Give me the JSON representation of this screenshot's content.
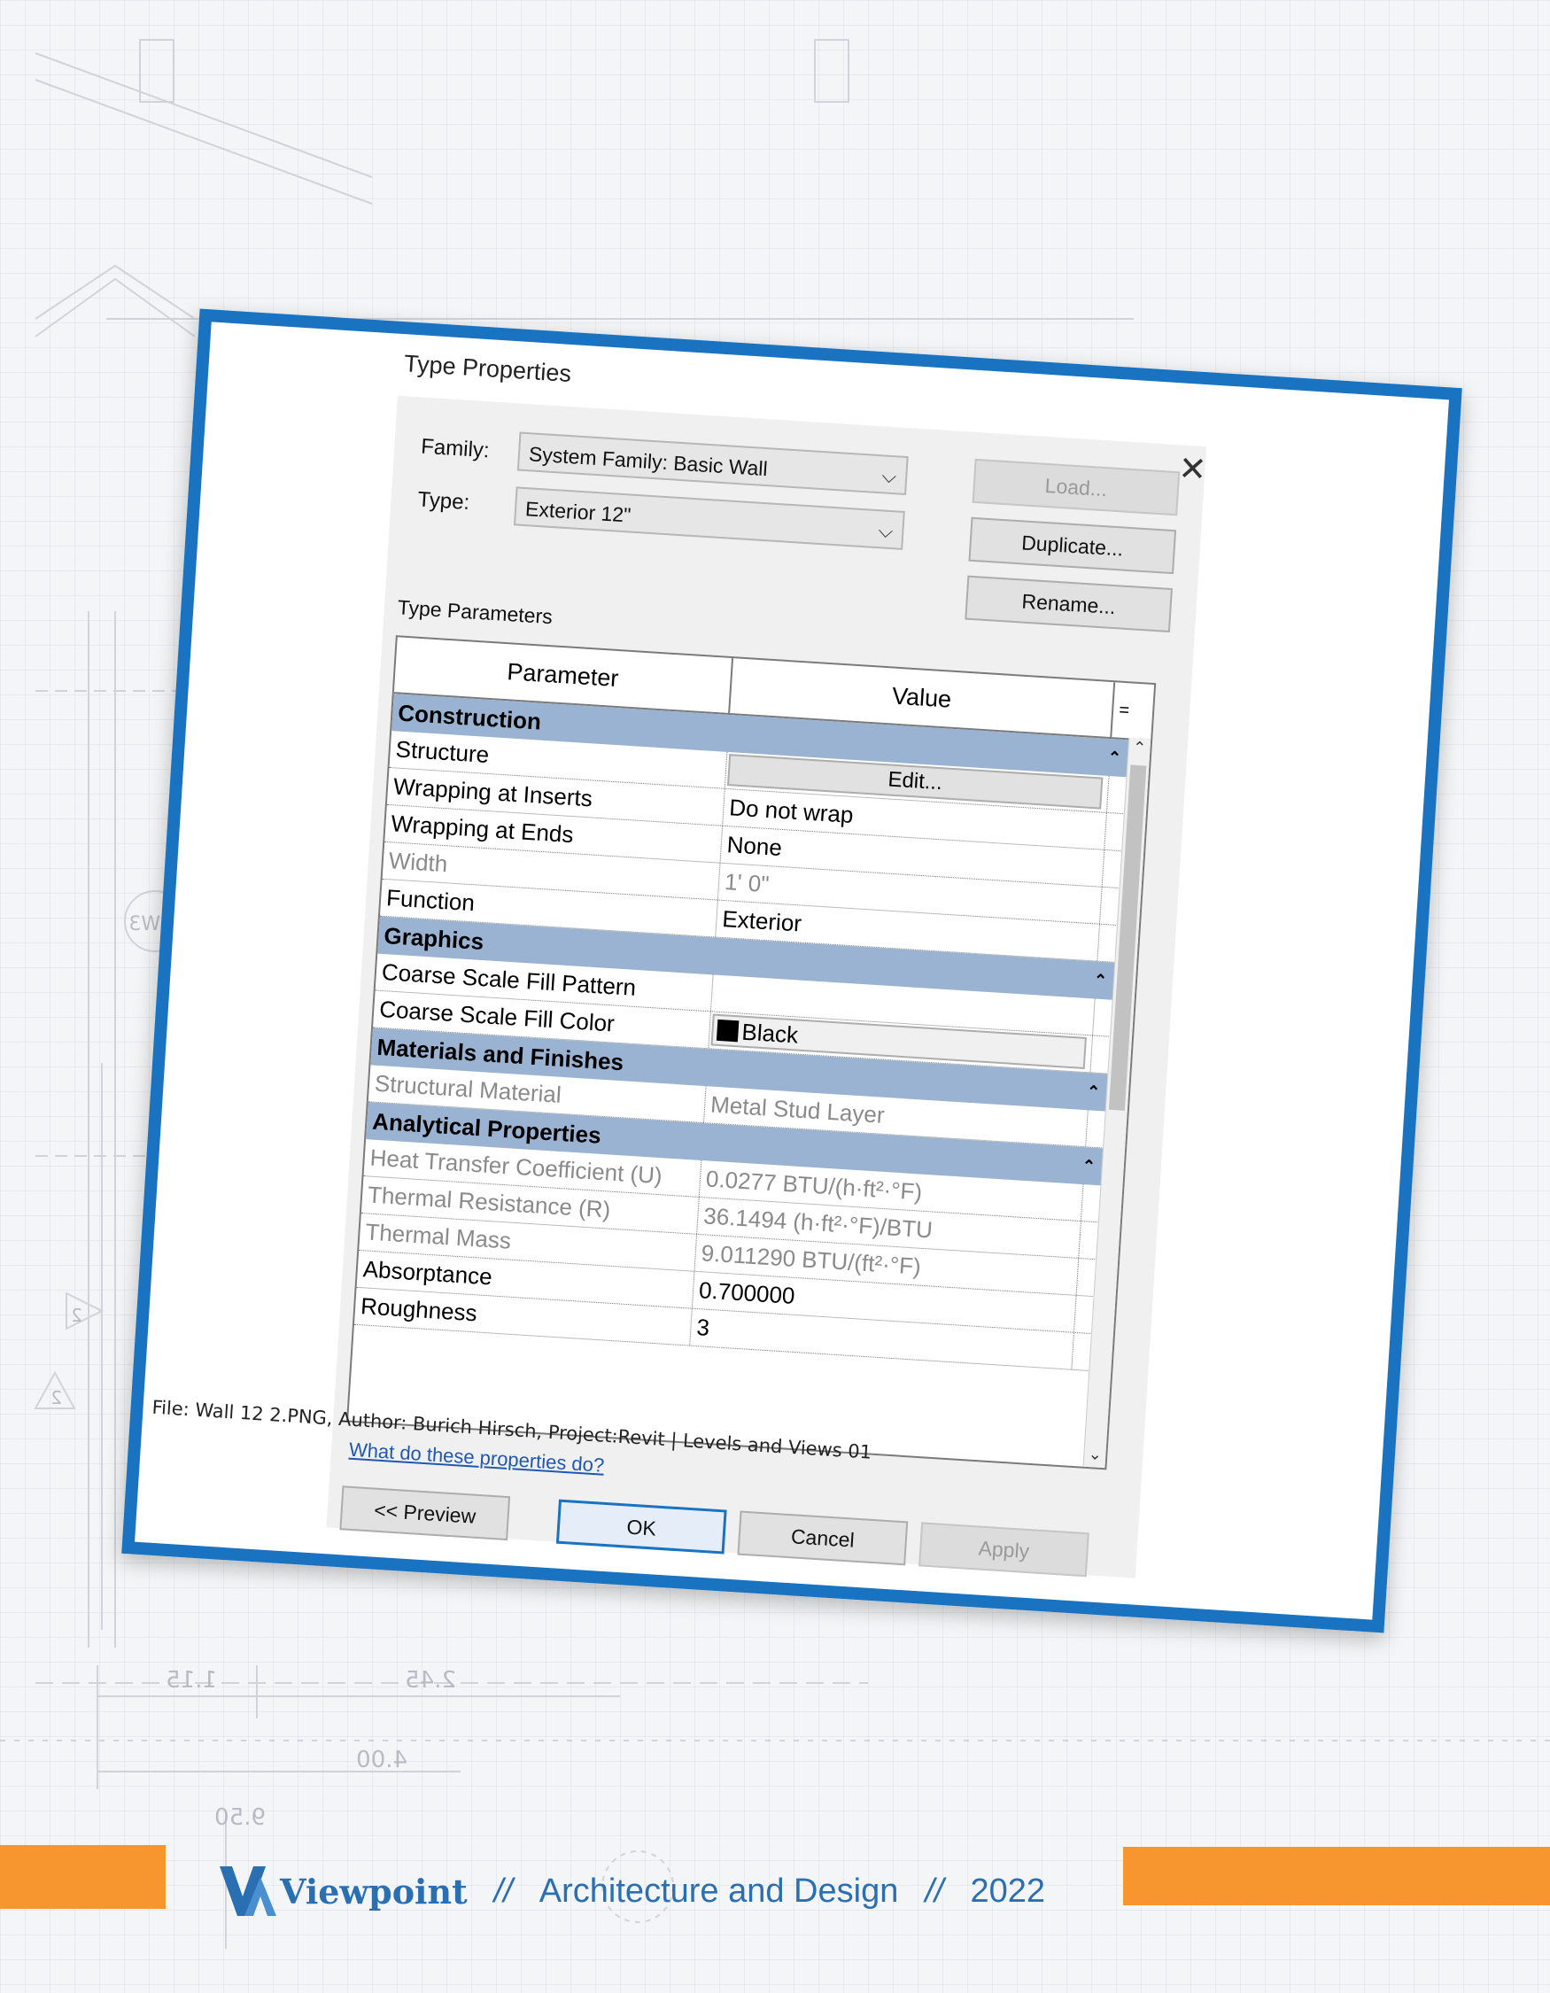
{
  "dialog": {
    "title": "Type Properties",
    "family_label": "Family:",
    "family_value": "System Family: Basic Wall",
    "type_label": "Type:",
    "type_value": "Exterior 12\"",
    "load_label": "Load...",
    "duplicate_label": "Duplicate...",
    "rename_label": "Rename...",
    "type_parameters_label": "Type Parameters",
    "col_parameter": "Parameter",
    "col_value": "Value",
    "col_eq": "=",
    "groups": {
      "construction": "Construction",
      "graphics": "Graphics",
      "materials": "Materials and Finishes",
      "analytical": "Analytical Properties"
    },
    "rows": {
      "structure": {
        "param": "Structure",
        "value": "Edit..."
      },
      "wrap_inserts": {
        "param": "Wrapping at Inserts",
        "value": "Do not wrap"
      },
      "wrap_ends": {
        "param": "Wrapping at Ends",
        "value": "None"
      },
      "width": {
        "param": "Width",
        "value": "1'  0\""
      },
      "function": {
        "param": "Function",
        "value": "Exterior"
      },
      "fill_pattern": {
        "param": "Coarse Scale Fill Pattern",
        "value": ""
      },
      "fill_color": {
        "param": "Coarse Scale Fill Color",
        "value": "Black"
      },
      "structural_material": {
        "param": "Structural Material",
        "value": "Metal Stud Layer"
      },
      "heat_transfer": {
        "param": "Heat Transfer Coefficient (U)",
        "value": "0.0277 BTU/(h·ft²·°F)"
      },
      "thermal_resistance": {
        "param": "Thermal Resistance (R)",
        "value": "36.1494 (h·ft²·°F)/BTU"
      },
      "thermal_mass": {
        "param": "Thermal Mass",
        "value": "9.011290 BTU/(ft²·°F)"
      },
      "absorptance": {
        "param": "Absorptance",
        "value": "0.700000"
      },
      "roughness": {
        "param": "Roughness",
        "value": "3"
      }
    },
    "help_link": "What do these properties do?",
    "preview_label": "<< Preview",
    "ok_label": "OK",
    "cancel_label": "Cancel",
    "apply_label": "Apply"
  },
  "caption": "File: Wall 12 2.PNG, Author: Burich Hirsch, Project:Revit | Levels and Views 01",
  "footer": {
    "brand": "Viewpoint",
    "separator": "//",
    "section": "Architecture and Design",
    "year": "2022"
  },
  "blueprint_labels": [
    "1.15",
    "2.45",
    "4.00",
    "9.50",
    "EW3",
    "2",
    "2"
  ],
  "colors": {
    "frame_blue": "#1a73c0",
    "group_header": "#9bb3d2",
    "footer_orange": "#f7962f",
    "footer_text": "#2a6fb1"
  }
}
